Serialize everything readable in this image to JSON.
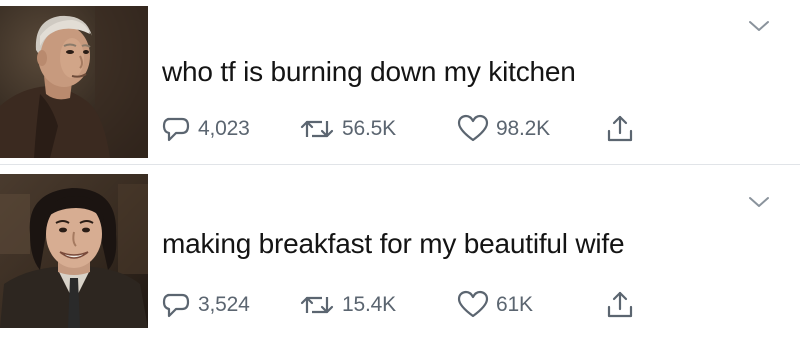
{
  "tweets": [
    {
      "text": "who tf is burning down my kitchen",
      "replies": "4,023",
      "retweets": "56.5K",
      "likes": "98.2K"
    },
    {
      "text": "making breakfast for my beautiful wife",
      "replies": "3,524",
      "retweets": "15.4K",
      "likes": "61K"
    }
  ],
  "icons": {
    "reply": "reply-icon",
    "retweet": "retweet-icon",
    "like": "heart-icon",
    "share": "share-icon",
    "more": "chevron-down-icon"
  },
  "colors": {
    "icon": "#5b6570",
    "text": "#141414",
    "divider": "#e1e4e8"
  }
}
